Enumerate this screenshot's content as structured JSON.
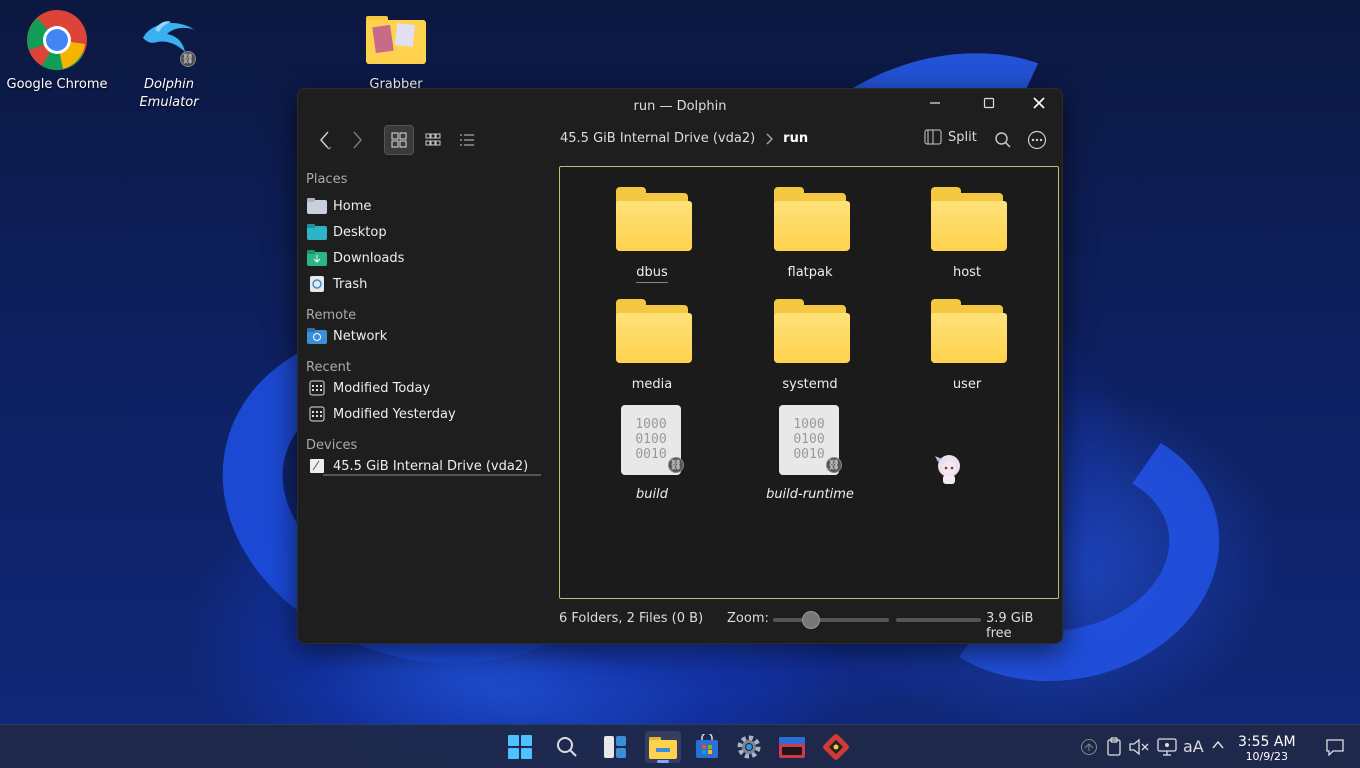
{
  "desktop": {
    "icons": [
      {
        "label": "Google Chrome"
      },
      {
        "label": "Dolphin Emulator"
      },
      {
        "label": "Grabber"
      }
    ]
  },
  "window": {
    "title": "run — Dolphin",
    "breadcrumb": [
      "45.5 GiB Internal Drive (vda2)",
      "run"
    ],
    "split_label": "Split",
    "sidebar": {
      "sections": [
        {
          "title": "Places",
          "items": [
            "Home",
            "Desktop",
            "Downloads",
            "Trash"
          ]
        },
        {
          "title": "Remote",
          "items": [
            "Network"
          ]
        },
        {
          "title": "Recent",
          "items": [
            "Modified Today",
            "Modified Yesterday"
          ]
        },
        {
          "title": "Devices",
          "items": [
            "45.5 GiB Internal Drive (vda2)"
          ]
        }
      ]
    },
    "files": [
      {
        "name": "dbus",
        "type": "folder"
      },
      {
        "name": "flatpak",
        "type": "folder"
      },
      {
        "name": "host",
        "type": "folder"
      },
      {
        "name": "media",
        "type": "folder"
      },
      {
        "name": "systemd",
        "type": "folder"
      },
      {
        "name": "user",
        "type": "folder"
      },
      {
        "name": "build",
        "type": "symlink-file"
      },
      {
        "name": "build-runtime",
        "type": "symlink-file"
      }
    ],
    "binary_glyph": [
      "1000",
      "0100",
      "0010"
    ],
    "status": "6 Folders, 2 Files (0 B)",
    "zoom_label": "Zoom:",
    "free_space": "3.9 GiB free"
  },
  "taskbar": {
    "clock_time": "3:55 AM",
    "clock_date": "10/9/23",
    "tray_text_size": "aA"
  },
  "colors": {
    "folder": "#ffd24d",
    "focus_border": "#b8c070",
    "accent": "#7aa9ff"
  }
}
